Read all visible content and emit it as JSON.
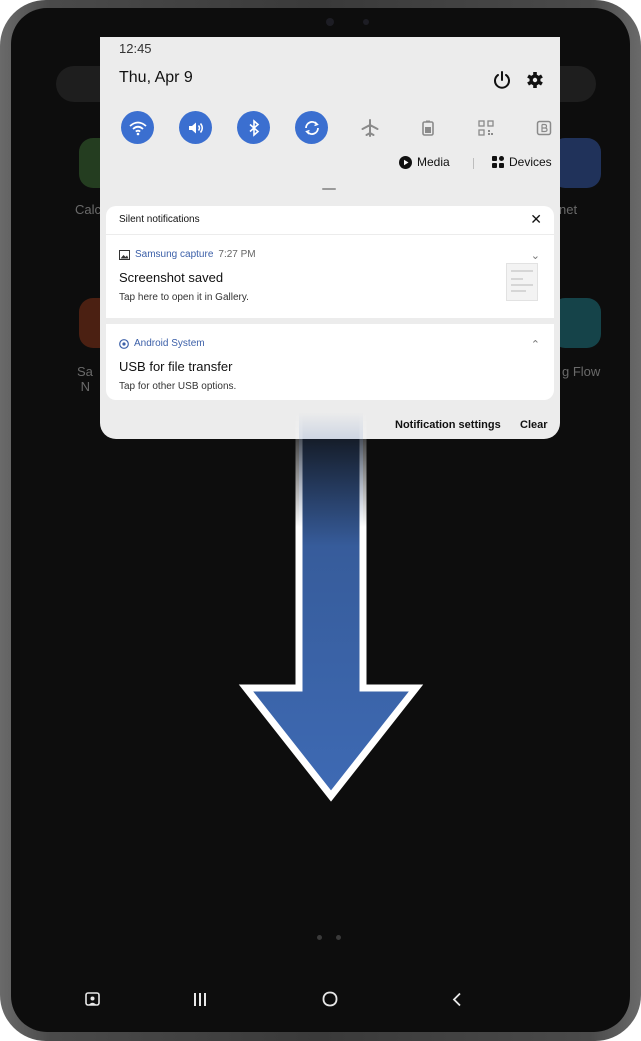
{
  "status": {
    "time": "12:45"
  },
  "header": {
    "date": "Thu, Apr 9"
  },
  "quick_settings": [
    {
      "name": "wifi-icon",
      "state": "on"
    },
    {
      "name": "volume-icon",
      "state": "on"
    },
    {
      "name": "bluetooth-icon",
      "state": "on"
    },
    {
      "name": "auto-rotate-icon",
      "state": "on"
    },
    {
      "name": "airplane-icon",
      "state": "off"
    },
    {
      "name": "battery-saver-icon",
      "state": "off"
    },
    {
      "name": "qr-scanner-icon",
      "state": "off"
    },
    {
      "name": "bixby-routine-icon",
      "state": "off"
    }
  ],
  "media_row": {
    "media_label": "Media",
    "devices_label": "Devices"
  },
  "silent_section": {
    "title": "Silent notifications"
  },
  "notifications": [
    {
      "app": "Samsung capture",
      "time": "7:27 PM",
      "title": "Screenshot saved",
      "subtitle": "Tap here to open it in Gallery."
    },
    {
      "app": "Android System",
      "time": "",
      "title": "USB for file transfer",
      "subtitle": "Tap for other USB options."
    }
  ],
  "footer": {
    "settings_label": "Notification settings",
    "clear_label": "Clear"
  },
  "colors": {
    "accent": "#3b6fd0",
    "arrow": "#3e6ab4",
    "panel_bg": "#ececec"
  }
}
